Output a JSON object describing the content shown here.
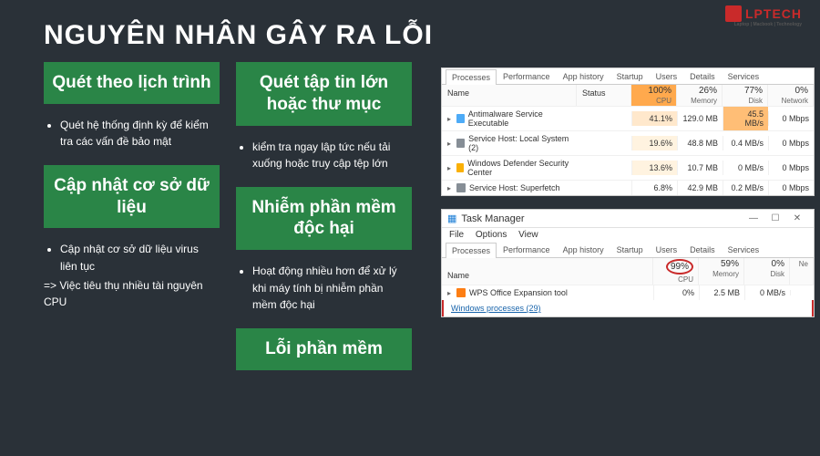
{
  "logo": {
    "text": "LPTECH",
    "sub": "Laptop | Macbook | Technology"
  },
  "title": "NGUYÊN NHÂN GÂY RA LỖI",
  "cards": {
    "c1": {
      "title": "Quét theo lịch trình",
      "desc": "Quét hệ thống định kỳ để kiểm tra các vấn đề bảo mật"
    },
    "c2": {
      "title": "Cập nhật cơ sở dữ liệu",
      "desc": "Cập nhật cơ sở dữ liệu virus liên tục",
      "conclusion": "=> Việc tiêu thụ nhiều tài nguyên CPU"
    },
    "c3": {
      "title": "Quét tập tin lớn hoặc thư mục",
      "desc": "kiểm tra ngay lập tức nếu tải xuống hoặc truy cập tệp lớn"
    },
    "c4": {
      "title": "Nhiễm phần mềm độc hại",
      "desc": "Hoạt động nhiều hơn để xử lý khi máy tính bị nhiễm phần mềm độc hại"
    },
    "c5": {
      "title": "Lỗi phần mềm"
    }
  },
  "tm1": {
    "tabs": [
      "Processes",
      "Performance",
      "App history",
      "Startup",
      "Users",
      "Details",
      "Services"
    ],
    "head": {
      "name": "Name",
      "status": "Status",
      "cols": [
        {
          "pct": "100%",
          "lbl": "CPU",
          "hot": true
        },
        {
          "pct": "26%",
          "lbl": "Memory",
          "hot": false
        },
        {
          "pct": "77%",
          "lbl": "Disk",
          "hot": false
        },
        {
          "pct": "0%",
          "lbl": "Network",
          "hot": false
        }
      ]
    },
    "rows": [
      {
        "name": "Antimalware Service Executable",
        "vals": [
          "41.1%",
          "129.0 MB",
          "45.5 MB/s",
          "0 Mbps"
        ],
        "heat": [
          "heat-warm",
          "",
          "heat-hot",
          ""
        ]
      },
      {
        "name": "Service Host: Local System (2)",
        "vals": [
          "19.6%",
          "48.8 MB",
          "0.4 MB/s",
          "0 Mbps"
        ],
        "heat": [
          "heat-med",
          "",
          "",
          ""
        ]
      },
      {
        "name": "Windows Defender Security Center",
        "vals": [
          "13.6%",
          "10.7 MB",
          "0 MB/s",
          "0 Mbps"
        ],
        "heat": [
          "heat-med",
          "",
          "",
          ""
        ]
      },
      {
        "name": "Service Host: Superfetch",
        "vals": [
          "6.8%",
          "42.9 MB",
          "0.2 MB/s",
          "0 Mbps"
        ],
        "heat": [
          "",
          "",
          "",
          ""
        ]
      }
    ]
  },
  "tm2": {
    "title": "Task Manager",
    "menu": [
      "File",
      "Options",
      "View"
    ],
    "tabs": [
      "Processes",
      "Performance",
      "App history",
      "Startup",
      "Users",
      "Details",
      "Services"
    ],
    "head": {
      "name": "Name",
      "cols": [
        {
          "pct": "99%",
          "lbl": "CPU",
          "circle": true
        },
        {
          "pct": "59%",
          "lbl": "Memory"
        },
        {
          "pct": "0%",
          "lbl": "Disk"
        },
        {
          "pct": "",
          "lbl": "Ne"
        }
      ]
    },
    "rows": [
      {
        "name": "WPS Office Expansion tool",
        "vals": [
          "0%",
          "2.5 MB",
          "0 MB/s",
          ""
        ]
      }
    ],
    "group": "Windows processes (29)"
  }
}
